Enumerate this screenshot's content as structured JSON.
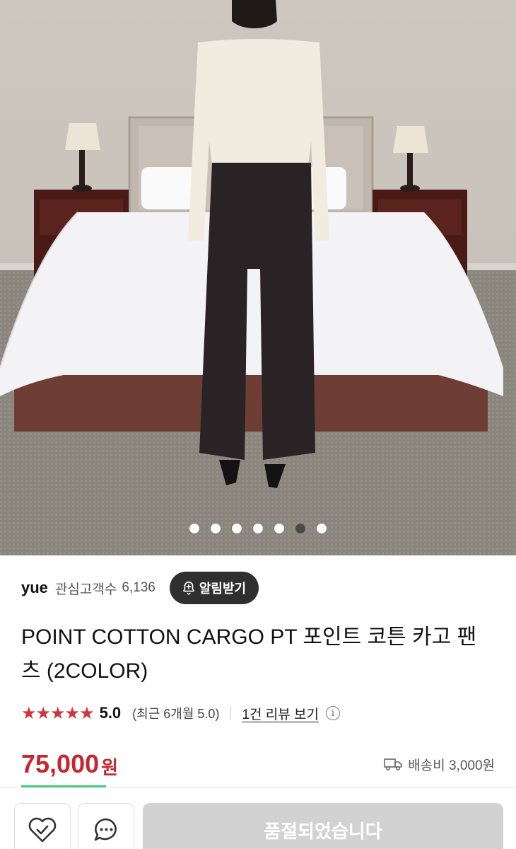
{
  "gallery": {
    "image_alt": "product photo",
    "slide_count": 7,
    "active_index": 5
  },
  "seller": {
    "name": "yue",
    "fan_label": "관심고객수",
    "fan_count": "6,136",
    "alert_button": "알림받기"
  },
  "product": {
    "title": "POINT COTTON CARGO PT 포인트 코튼 카고 팬츠 (2COLOR)"
  },
  "rating": {
    "stars": "★★★★★",
    "score": "5.0",
    "recent": "(최근 6개월 5.0)",
    "review_link": "1건 리뷰 보기",
    "info_icon": "i"
  },
  "price": {
    "amount": "75,000",
    "currency": "원"
  },
  "shipping": {
    "text": "배송비 3,000원",
    "icon": "truck-icon"
  },
  "bottom_bar": {
    "soldout_label": "품절되었습니다",
    "like_icon": "heart-check-icon",
    "chat_icon": "chat-bubble-icon"
  },
  "colors": {
    "price_red": "#c8262f",
    "star_red": "#d0353f",
    "alert_bg": "#2f2f2f",
    "soldout_bg": "#d2d2d2"
  }
}
